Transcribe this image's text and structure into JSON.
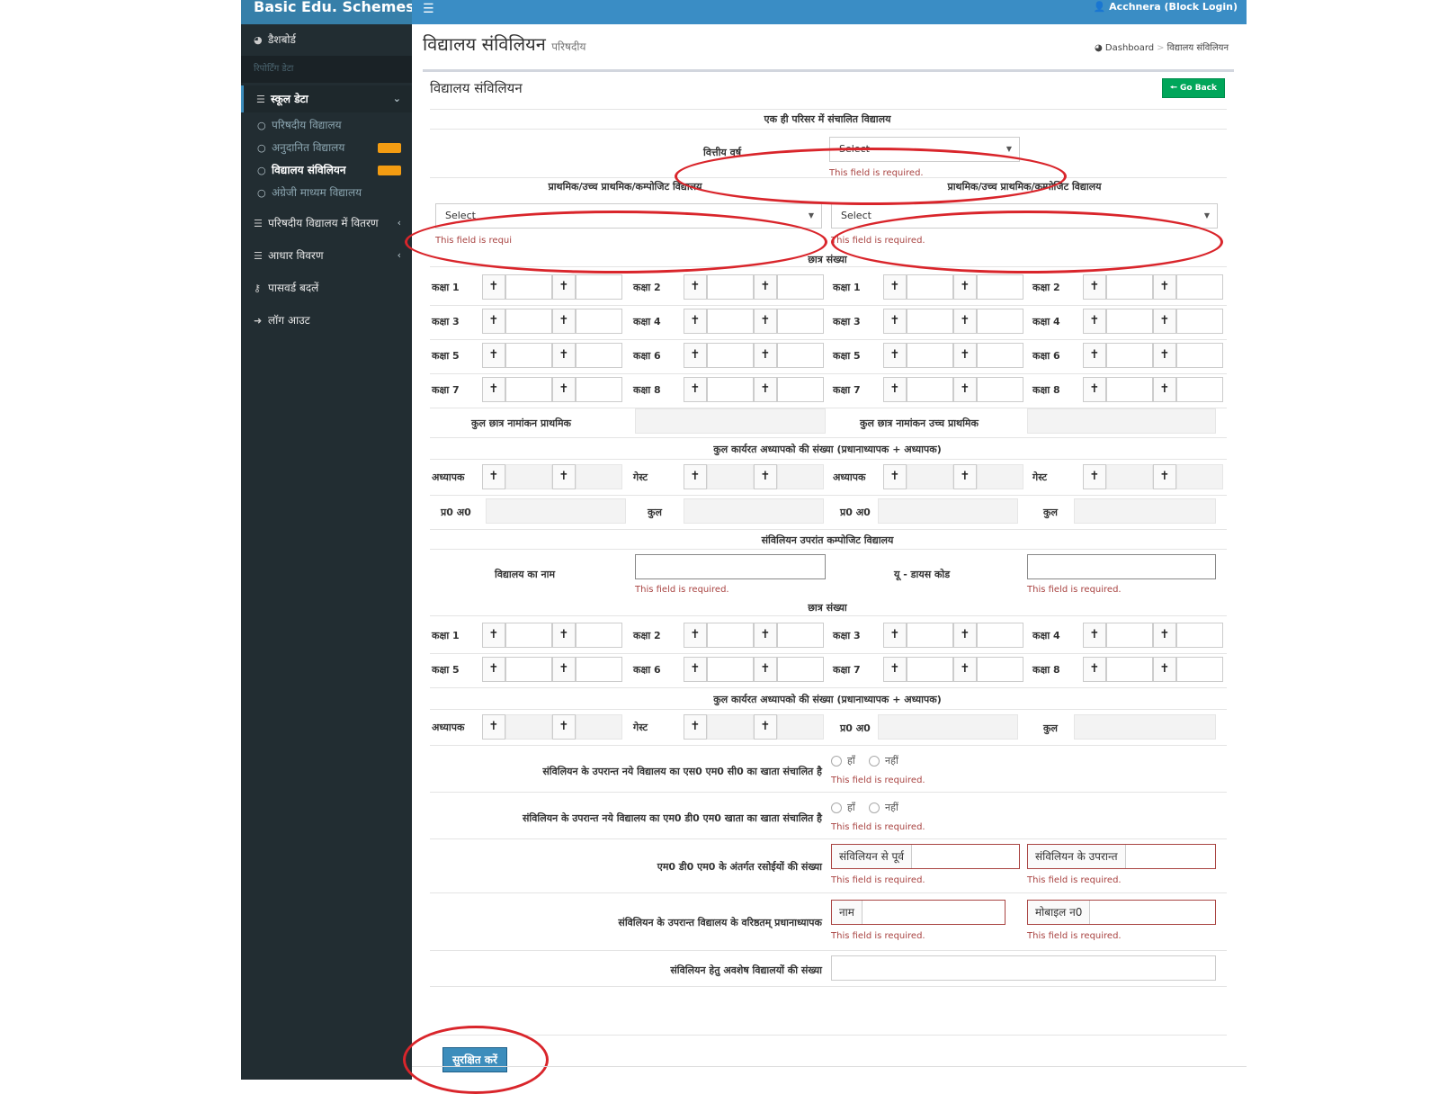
{
  "app": {
    "brand": "Basic Edu. Schemes",
    "user": "Acchnera (Block Login)"
  },
  "sidebar": {
    "dashboard": "डैशबोर्ड",
    "reporting_header": "रिपोर्टिंग डेटा",
    "school_data": "स्कूल डेटा",
    "sub_items": [
      "परिषदीय विद्यालय",
      "अनुदानित विद्यालय",
      "विद्यालय संविलियन",
      "अंग्रेजी माध्यम विद्यालय"
    ],
    "distribution": "परिषदीय विद्यालय में वितरण",
    "aadhaar": "आधार विवरण",
    "password": "पासवर्ड बदलें",
    "logout": "लॉग आउट"
  },
  "page": {
    "title": "विद्यालय संविलियन",
    "subtitle": "परिषदीय"
  },
  "breadcrumb": {
    "home": "Dashboard",
    "current": "विद्यालय संविलियन"
  },
  "form": {
    "box_title": "विद्यालय संविलियन",
    "go_back": "Go Back",
    "section_header": "एक ही परिसर में संचालित विद्यालय",
    "fy_label": "वित्तीय वर्ष",
    "select_placeholder": "Select",
    "school_type_label": "प्राथमिक/उच्च प्राथमिक/कम्पोजिट विद्यालय",
    "required": "This field is required.",
    "required_cut": "This field is requi",
    "student_count": "छात्र संख्या",
    "class_prefix": "कक्षा",
    "class_nums": [
      "1",
      "2",
      "3",
      "4",
      "5",
      "6",
      "7",
      "8"
    ],
    "total_primary": "कुल छात्र नामांकन प्राथमिक",
    "total_upper": "कुल छात्र नामांकन उच्च प्राथमिक",
    "teachers_header": "कुल कार्यरत अध्यापको की संख्या (प्रधानाध्यापक + अध्यापक)",
    "teacher": "अध्यापक",
    "guest": "गेस्ट",
    "head": "प्र0 अ0",
    "total": "कुल",
    "composite_header": "संविलियन उपरांत कम्पोजिट विद्यालय",
    "school_name": "विद्यालय का नाम",
    "udise": "यू - डायस कोड",
    "q_smc": "संविलियन के उपरान्त नये विद्यालय का एस0 एम0 सी0 का खाता संचालित है",
    "q_mdm": "संविलियन के उपरान्त नये विद्यालय का एम0 डी0 एम0 खाता का खाता संचालित है",
    "yes": "हाँ",
    "no": "नहीं",
    "kitchens": "एम0 डी0 एम0 के अंतर्गत रसोईयों की संख्या",
    "before": "संविलियन से पूर्व",
    "after": "संविलियन के उपरान्त",
    "senior_head": "संविलियन के उपरान्त विद्यालय के वरिष्ठतम् प्रधानाध्यापक",
    "name": "नाम",
    "mobile": "मोबाइल न0",
    "remaining": "संविलियन हेतु अवशेष विद्यालयों की संख्या",
    "save": "सुरक्षित करें"
  },
  "colors": {
    "topbar": "#3a8dc5",
    "sidebar": "#222d32",
    "accent": "#3c8dbc",
    "success": "#00a65a",
    "error": "#a94442",
    "annotation": "#d9252b"
  },
  "icons": [
    "menu-icon",
    "user-icon",
    "dashboard-icon",
    "list-icon",
    "circle-icon",
    "chevron-icon",
    "key-icon",
    "logout-icon",
    "arrow-left-icon",
    "male-icon",
    "female-icon"
  ]
}
